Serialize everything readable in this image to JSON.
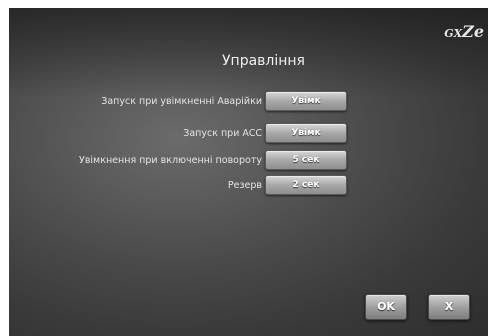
{
  "logo": {
    "prefix": "GX",
    "mark": "Ze"
  },
  "title": "Управління",
  "settings": [
    {
      "label": "Запуск при увімкненні Аварійки",
      "value": "Увімк"
    },
    {
      "label": "Запуск при ACC",
      "value": "Увімк"
    },
    {
      "label": "Увімкнення при включенні повороту",
      "value": "5 сек"
    },
    {
      "label": "Резерв",
      "value": "2 сек"
    }
  ],
  "footer": {
    "ok_label": "OK",
    "close_label": "X"
  }
}
